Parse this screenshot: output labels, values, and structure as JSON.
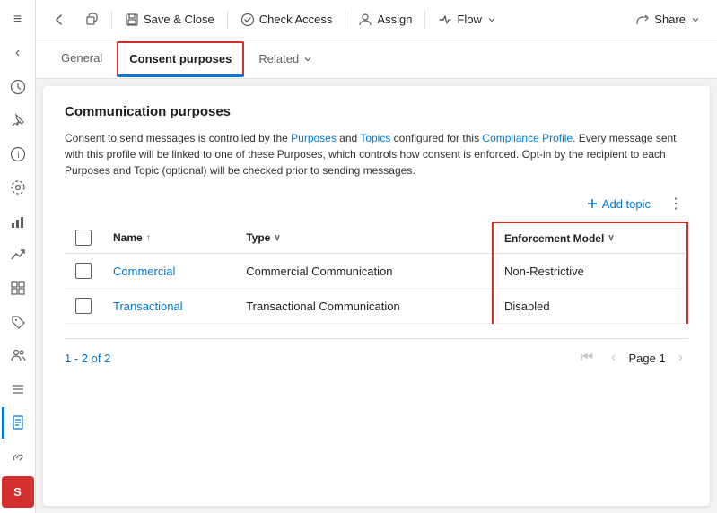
{
  "toolbar": {
    "back_label": "←",
    "forward_label": "→",
    "save_close_label": "Save & Close",
    "check_access_label": "Check Access",
    "assign_label": "Assign",
    "flow_label": "Flow",
    "share_label": "Share"
  },
  "nav": {
    "tabs": [
      {
        "id": "general",
        "label": "General"
      },
      {
        "id": "consent_purposes",
        "label": "Consent purposes"
      },
      {
        "id": "related",
        "label": "Related"
      }
    ]
  },
  "content": {
    "section_title": "Communication purposes",
    "info_text_part1": "Consent to send messages is controlled by the Purposes and Topics configured for this Compliance Profile. Every message sent with this profile will be linked to one of these Purposes, which controls how consent is enforced. Opt-in by the recipient to each Purposes and Topic (optional) will be checked prior to sending messages.",
    "add_topic_label": "Add topic",
    "table": {
      "columns": [
        {
          "id": "checkbox",
          "label": ""
        },
        {
          "id": "name",
          "label": "Name",
          "sort": "↑"
        },
        {
          "id": "type",
          "label": "Type",
          "sort": "↓"
        },
        {
          "id": "enforcement",
          "label": "Enforcement Model",
          "sort": "↓"
        }
      ],
      "rows": [
        {
          "name": "Commercial",
          "type": "Commercial Communication",
          "enforcement": "Non-Restrictive"
        },
        {
          "name": "Transactional",
          "type": "Transactional Communication",
          "enforcement": "Disabled"
        }
      ]
    },
    "pagination": {
      "count_label": "1 - 2 of 2",
      "page_label": "Page 1"
    }
  },
  "sidebar": {
    "icons": [
      {
        "id": "menu",
        "symbol": "≡"
      },
      {
        "id": "recent",
        "symbol": "🕐"
      },
      {
        "id": "pin",
        "symbol": "📌"
      },
      {
        "id": "info",
        "symbol": "ℹ"
      },
      {
        "id": "settings",
        "symbol": "⚙"
      },
      {
        "id": "chart",
        "symbol": "📊"
      },
      {
        "id": "trend",
        "symbol": "📈"
      },
      {
        "id": "grid",
        "symbol": "⊞"
      },
      {
        "id": "tag",
        "symbol": "🏷"
      },
      {
        "id": "people",
        "symbol": "👥"
      },
      {
        "id": "list",
        "symbol": "📋"
      },
      {
        "id": "doc",
        "symbol": "📄"
      },
      {
        "id": "link",
        "symbol": "🔗"
      },
      {
        "id": "user",
        "symbol": "S"
      }
    ]
  }
}
